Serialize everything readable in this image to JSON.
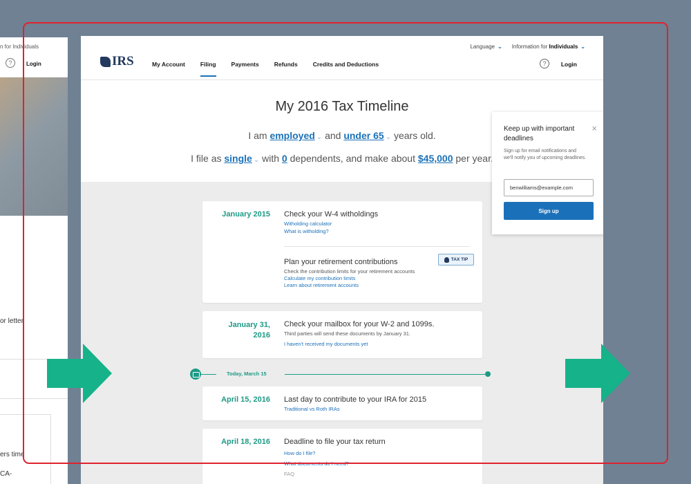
{
  "bg_page": {
    "info": "n for Individuals",
    "help": "?",
    "login": "Login",
    "letter_text": "or letter",
    "text1": "ers time",
    "text2": "CA-"
  },
  "nav": {
    "logo_text": "IRS",
    "links": [
      "My Account",
      "Filing",
      "Payments",
      "Refunds",
      "Credits and Deductions"
    ],
    "language": "Language",
    "info_prefix": "Information for",
    "info_bold": "Individuals",
    "help": "?",
    "login": "Login"
  },
  "hero": {
    "title": "My 2016 Tax Timeline",
    "line1": {
      "t1": "I am ",
      "s1": "employed",
      "t2": "  and ",
      "s2": "under 65",
      "t3": "  years old."
    },
    "line2": {
      "t1": "I file as ",
      "s1": "single",
      "t2": " with ",
      "s2": "0",
      "t3": " dependents, and make about ",
      "s3": "$45,000",
      "t4": " per year."
    }
  },
  "timeline": {
    "card1": {
      "date": "January 2015",
      "title": "Check your W-4 witholdings",
      "link1": "Witholding calculator",
      "link2": "What is witholding?",
      "title2": "Plan your retirement contributions",
      "desc2": "Check the contribution limits for your retirement accounts",
      "link3": "Calculate my contribution limits",
      "link4": "Learn about retirement accounts",
      "tip": "TAX TIP"
    },
    "card2": {
      "date_line1": "January 31,",
      "date_line2": "2016",
      "title": "Check your mailbox for your W-2 and 1099s.",
      "desc": "Third parties will send these documents by January 31.",
      "link": "I haven't received my documents yet"
    },
    "today": "Today, March 15",
    "card3": {
      "date": "April 15, 2016",
      "title": "Last day to contribute to your IRA for 2015",
      "link": "Traditional vs Roth IRAs"
    },
    "card4": {
      "date": "April 18, 2016",
      "title": "Deadline to file your tax return",
      "link1": "How do I file?",
      "link2": "What documents do I need?",
      "link3": "FAQ"
    }
  },
  "popup": {
    "title": "Keep up with important deadlines",
    "desc": "Sign up for email notifications and we'll notify you of upcoming deadlines.",
    "email": "benwilliams@example.com",
    "button": "Sign up",
    "close": "×"
  },
  "colors": {
    "accent": "#1b71b9",
    "teal": "#1e9a86",
    "arrow": "#16b289",
    "frame": "#e0212e"
  }
}
